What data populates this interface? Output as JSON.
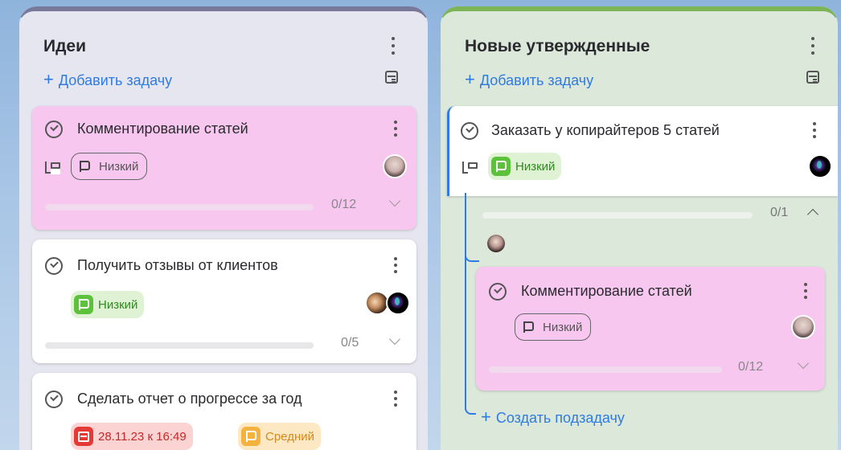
{
  "columns": [
    {
      "title": "Идеи",
      "add_task_label": "Добавить задачу",
      "cards": [
        {
          "title": "Комментирование статей",
          "priority": "Низкий",
          "progress": "0/12",
          "progress_fraction": 0
        },
        {
          "title": "Получить отзывы от клиентов",
          "priority": "Низкий",
          "progress": "0/5",
          "progress_fraction": 0
        },
        {
          "title": "Сделать отчет о прогрессе за год",
          "date": "28.11.23 к 16:49",
          "priority": "Средний"
        }
      ]
    },
    {
      "title": "Новые утвержденные",
      "add_task_label": "Добавить задачу",
      "cards": [
        {
          "title": "Заказать у копирайтеров 5 статей",
          "priority": "Низкий",
          "progress": "0/1",
          "progress_fraction": 0,
          "subtasks": [
            {
              "title": "Комментирование статей",
              "priority": "Низкий",
              "progress": "0/12",
              "progress_fraction": 0
            }
          ],
          "create_subtask_label": "Создать подзадачу"
        }
      ]
    }
  ],
  "colors": {
    "accent_blue": "#2f7be6",
    "column_ideas_bar": "#78789a",
    "column_new_bar": "#7cb456",
    "card_pink": "#f7c7f0",
    "priority_low_green": "#5cc23c",
    "priority_medium": "#f3b33e",
    "date_red": "#e53935"
  }
}
